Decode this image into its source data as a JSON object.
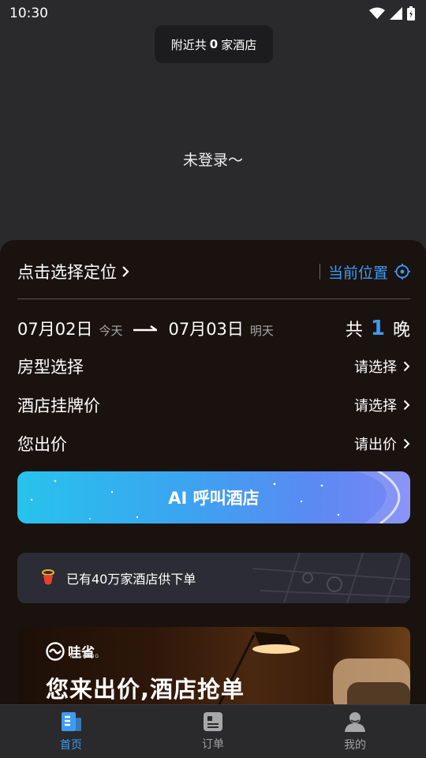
{
  "status_bar": {
    "time": "10:30"
  },
  "toast": {
    "prefix": "附近共",
    "count": "0",
    "suffix": "家酒店"
  },
  "login_text": "未登录～",
  "location": {
    "select_label": "点击选择定位",
    "current_label": "当前位置"
  },
  "dates": {
    "checkin_date": "07月02日",
    "checkin_sub": "今天",
    "checkout_date": "07月03日",
    "checkout_sub": "明天",
    "nights_prefix": "共",
    "nights_count": "1",
    "nights_suffix": "晚"
  },
  "options": [
    {
      "label": "房型选择",
      "value": "请选择"
    },
    {
      "label": "酒店挂牌价",
      "value": "请选择"
    },
    {
      "label": "您出价",
      "value": "请出价"
    }
  ],
  "ai_button_label": "AI 呼叫酒店",
  "banner_info": {
    "text": "已有40万家酒店供下单"
  },
  "promo": {
    "brand": "哇省",
    "brand_sub": "WASHENG",
    "slogan": "您来出价,酒店抢单"
  },
  "tabs": [
    {
      "label": "首页",
      "active": true,
      "icon": "home-doc-icon"
    },
    {
      "label": "订单",
      "active": false,
      "icon": "order-card-icon"
    },
    {
      "label": "我的",
      "active": false,
      "icon": "user-icon"
    }
  ],
  "colors": {
    "accent": "#3d9bf5",
    "panel": "#1a120e",
    "background": "#2a2a2c"
  }
}
